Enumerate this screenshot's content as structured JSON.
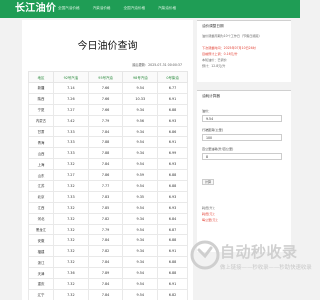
{
  "header": {
    "logo": "长江油价",
    "nav": [
      "全国汽油价格",
      "汽柴油价格",
      "全国汽油价格",
      "汽柴油价格"
    ]
  },
  "main": {
    "title": "今日油价查询",
    "update_time": "最后更新：2025-07-31 00:00:37",
    "table": {
      "headers": [
        "地区",
        "92号汽油",
        "95号汽油",
        "98号汽油",
        "0号柴油"
      ],
      "rows": [
        [
          "新疆",
          "7.14",
          "7.66",
          "9.54",
          "6.77"
        ],
        [
          "陕西",
          "7.26",
          "7.66",
          "10.33",
          "6.91"
        ],
        [
          "宁夏",
          "7.27",
          "7.66",
          "9.34",
          "6.88"
        ],
        [
          "内蒙古",
          "7.42",
          "7.79",
          "9.56",
          "6.93"
        ],
        [
          "甘肃",
          "7.33",
          "7.84",
          "9.34",
          "6.86"
        ],
        [
          "青海",
          "7.33",
          "7.88",
          "9.54",
          "6.91"
        ],
        [
          "山西",
          "7.33",
          "7.88",
          "9.34",
          "6.99"
        ],
        [
          "上海",
          "7.32",
          "7.84",
          "9.54",
          "6.93"
        ],
        [
          "山东",
          "7.27",
          "7.86",
          "9.59",
          "6.88"
        ],
        [
          "江苏",
          "7.32",
          "7.77",
          "9.54",
          "6.88"
        ],
        [
          "北京",
          "7.33",
          "7.83",
          "9.35",
          "6.93"
        ],
        [
          "江西",
          "7.32",
          "7.85",
          "9.54",
          "6.93"
        ],
        [
          "河北",
          "7.32",
          "7.82",
          "9.34",
          "6.84"
        ],
        [
          "黑龙江",
          "7.32",
          "7.79",
          "9.54",
          "6.87"
        ],
        [
          "安徽",
          "7.32",
          "7.84",
          "9.34",
          "6.88"
        ],
        [
          "福建",
          "7.32",
          "7.82",
          "9.34",
          "6.91"
        ],
        [
          "浙江",
          "7.32",
          "7.84",
          "9.34",
          "6.88"
        ],
        [
          "天津",
          "7.36",
          "7.89",
          "9.54",
          "6.88"
        ],
        [
          "重庆",
          "7.32",
          "7.84",
          "9.54",
          "6.91"
        ],
        [
          "辽宁",
          "7.32",
          "7.84",
          "9.54",
          "6.82"
        ]
      ]
    }
  },
  "sidebar": {
    "notice": {
      "title": "油价调整日期",
      "line1": "油价调整周期为10个工作日（节假日顺延）",
      "line2": "下次调整时间：2025年07月10日24时",
      "line3": "目前预计上调：0.16元/升",
      "line4": "本轮油价：已调价",
      "line5": "预计：12.8元/升"
    },
    "calc": {
      "title": "油耗计算器",
      "distance_label": "油价：",
      "distance_value": "9.54",
      "price_label": "行驶距离(公里)",
      "price_value": "100",
      "consumption_label": "百公里油耗(升/百公里)",
      "consumption_value": "8",
      "button": "计算",
      "result1": "耗费(升)：",
      "result2": "耗费(元)：",
      "result3": "每公里(元)："
    }
  },
  "watermark": {
    "brand": "自动秒收录",
    "subtitle": "做上链接——秒收录——秒助快速收录"
  }
}
